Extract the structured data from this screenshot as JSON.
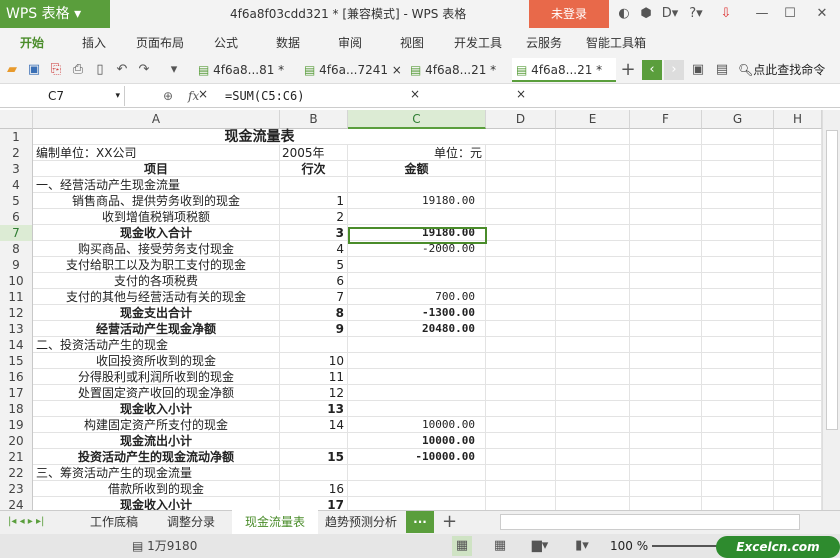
{
  "app": {
    "logo": "WPS 表格",
    "title": "4f6a8f03cdd321 * [兼容模式] - WPS 表格",
    "login": "未登录"
  },
  "menu": [
    "开始",
    "插入",
    "页面布局",
    "公式",
    "数据",
    "审阅",
    "视图",
    "开发工具",
    "云服务",
    "智能工具箱"
  ],
  "doc_tabs": [
    "4f6a8...81 * ×",
    "4f6a...7241 ×",
    "4f6a8...21 * ×",
    "4f6a8...21 * ×"
  ],
  "search_cmd": "点此查找命令",
  "formula_bar": {
    "name_box": "C7",
    "fx": "fx",
    "formula": "=SUM(C5:C6)"
  },
  "columns": [
    "A",
    "B",
    "C",
    "D",
    "E",
    "F",
    "G",
    "H"
  ],
  "rows": [
    {
      "n": "1",
      "a": "现金流量表",
      "b": "",
      "c": ""
    },
    {
      "n": "2",
      "a": "编制单位：XX公司",
      "b": "2005年",
      "c": "单位：元"
    },
    {
      "n": "3",
      "a": "项目",
      "b": "行次",
      "c": "金额"
    },
    {
      "n": "4",
      "a": "一、经营活动产生现金流量",
      "b": "",
      "c": ""
    },
    {
      "n": "5",
      "a": "销售商品、提供劳务收到的现金",
      "b": "1",
      "c": "19180.00"
    },
    {
      "n": "6",
      "a": "收到增值税销项税额",
      "b": "2",
      "c": ""
    },
    {
      "n": "7",
      "a": "现金收入合计",
      "b": "3",
      "c": "19180.00"
    },
    {
      "n": "8",
      "a": "购买商品、接受劳务支付现金",
      "b": "4",
      "c": "-2000.00"
    },
    {
      "n": "9",
      "a": "支付给职工以及为职工支付的现金",
      "b": "5",
      "c": ""
    },
    {
      "n": "10",
      "a": "支付的各项税费",
      "b": "6",
      "c": ""
    },
    {
      "n": "11",
      "a": "支付的其他与经营活动有关的现金",
      "b": "7",
      "c": "700.00"
    },
    {
      "n": "12",
      "a": "现金支出合计",
      "b": "8",
      "c": "-1300.00"
    },
    {
      "n": "13",
      "a": "经营活动产生现金净额",
      "b": "9",
      "c": "20480.00"
    },
    {
      "n": "14",
      "a": "二、投资活动产生的现金",
      "b": "",
      "c": ""
    },
    {
      "n": "15",
      "a": "收回投资所收到的现金",
      "b": "10",
      "c": ""
    },
    {
      "n": "16",
      "a": "分得股利或利润所收到的现金",
      "b": "11",
      "c": ""
    },
    {
      "n": "17",
      "a": "处置固定资产收回的现金净额",
      "b": "12",
      "c": ""
    },
    {
      "n": "18",
      "a": "现金收入小计",
      "b": "13",
      "c": ""
    },
    {
      "n": "19",
      "a": "构建固定资产所支付的现金",
      "b": "14",
      "c": "10000.00"
    },
    {
      "n": "20",
      "a": "现金流出小计",
      "b": "",
      "c": "10000.00"
    },
    {
      "n": "21",
      "a": "投资活动产生的现金流动净额",
      "b": "15",
      "c": "-10000.00"
    },
    {
      "n": "22",
      "a": "三、筹资活动产生的现金流量",
      "b": "",
      "c": ""
    },
    {
      "n": "23",
      "a": "借款所收到的现金",
      "b": "16",
      "c": ""
    },
    {
      "n": "24",
      "a": "现金收入小计",
      "b": "17",
      "c": ""
    }
  ],
  "sheet_tabs": [
    "工作底稿",
    "调整分录",
    "现金流量表",
    "趋势预测分析"
  ],
  "status": {
    "sum": "1万9180",
    "zoom": "100 %",
    "watermark": "Excelcn.com"
  }
}
